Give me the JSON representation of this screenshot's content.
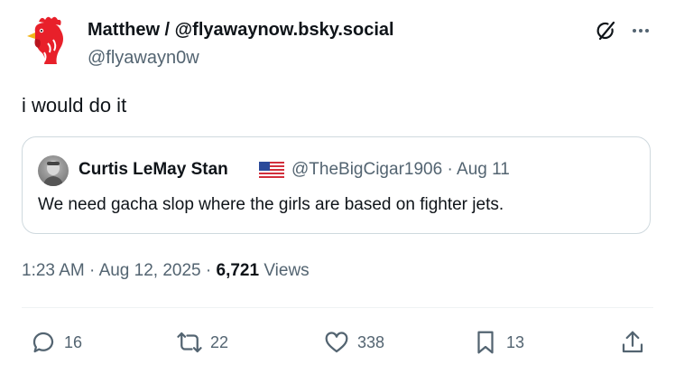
{
  "author": {
    "display_name": "Matthew / @flyawaynow.bsky.social",
    "handle": "@flyawayn0w"
  },
  "tweet": {
    "text": "i would do it",
    "time": "1:23 AM",
    "date": "Aug 12, 2025",
    "views_count": "6,721",
    "views_label": "Views"
  },
  "quote": {
    "display_name": "Curtis LeMay Stan",
    "handle": "@TheBigCigar1906",
    "date": "Aug 11",
    "text": "We need gacha slop where the girls are based on fighter jets."
  },
  "actions": {
    "replies": "16",
    "reposts": "22",
    "likes": "338",
    "bookmarks": "13"
  },
  "colors": {
    "text": "#0f1419",
    "secondary": "#536471",
    "border": "#cfd9de",
    "avatar_red": "#e8202a"
  },
  "icons": [
    "rooster-avatar-icon",
    "grok-icon",
    "more-icon",
    "flag-us-icon",
    "reply-icon",
    "repost-icon",
    "like-icon",
    "bookmark-icon",
    "share-icon"
  ]
}
